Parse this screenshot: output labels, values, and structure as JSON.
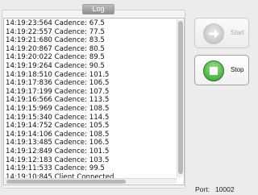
{
  "log": {
    "title": "Log",
    "lines": [
      "14:19:23:564 Cadence: 67.5",
      "14:19:22:557 Cadence: 77.5",
      "14:19:21:680 Cadence: 83.5",
      "14:19:20:867 Cadence: 80.5",
      "14:19:20:022 Cadence: 89.5",
      "14:19:19:264 Cadence: 90.5",
      "14:19:18:510 Cadence: 101.5",
      "14:19:17:836 Cadence: 106.5",
      "14:19:17:199 Cadence: 107.5",
      "14:19:16:566 Cadence: 113.5",
      "14:19:15:969 Cadence: 108.5",
      "14:19:15:340 Cadence: 114.5",
      "14:19:14:752 Cadence: 105.5",
      "14:19:14:106 Cadence: 108.5",
      "14:19:13:485 Cadence: 106.5",
      "14:19:12:849 Cadence: 101.5",
      "14:19:12:183 Cadence: 103.5",
      "14:19:11:533 Cadence: 99.5",
      "14:19:10:845 Client Connected"
    ]
  },
  "controls": {
    "start_label": "Start",
    "stop_label": "Stop",
    "start_icon": "arrow-right-icon",
    "stop_icon": "stop-square-icon"
  },
  "status": {
    "port_label": "Port:",
    "port_value": "10002"
  },
  "colors": {
    "stop_green": "#2e9a2a",
    "disabled_gray": "#b9b9b9"
  }
}
